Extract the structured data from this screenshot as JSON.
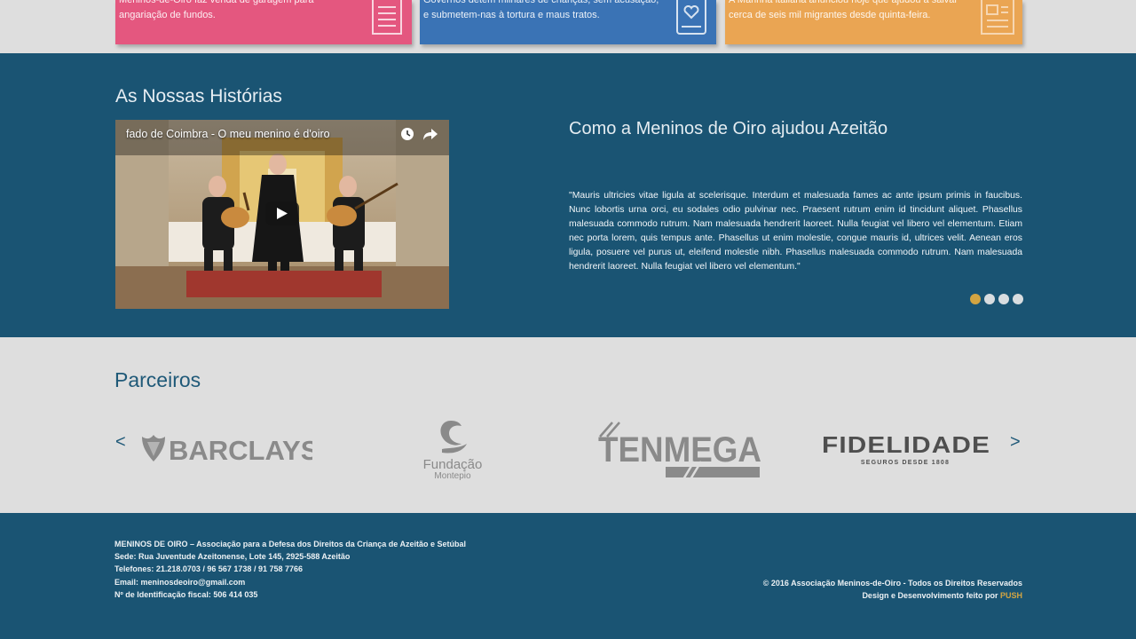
{
  "top_cards": [
    {
      "text": "Meninos-de-Oiro faz venda de garagem para angariação de fundos.",
      "color": "#e4577f",
      "icon": "newspaper-icon"
    },
    {
      "text": "Governos detêm milhares de crianças, sem acusação, e submetem-nas à tortura e maus tratos.",
      "color": "#3a73b5",
      "icon": "tablet-heart-icon"
    },
    {
      "text": "A Marinha italiana anunciou hoje que ajudou a salvar cerca de seis mil migrantes desde quinta-feira.",
      "color": "#eaa553",
      "icon": "newspaper-icon"
    }
  ],
  "stories": {
    "title": "As Nossas Histórias",
    "video": {
      "title": "fado de Coimbra - O meu menino é d'oiro"
    },
    "heading": "Como a Meninos de Oiro ajudou Azeitão",
    "quote": "\"Mauris ultricies vitae ligula at scelerisque. Interdum et malesuada fames ac ante ipsum primis in faucibus. Nunc lobortis urna orci, eu sodales odio pulvinar nec. Praesent rutrum enim id tincidunt aliquet. Phasellus malesuada commodo rutrum. Nam malesuada hendrerit laoreet. Nulla feugiat vel libero vel elementum. Etiam nec porta lorem, quis tempus ante. Phasellus ut enim molestie, congue mauris id, ultrices velit. Aenean eros ligula, posuere vel purus ut, eleifend molestie nibh. Phasellus malesuada commodo rutrum. Nam malesuada hendrerit laoreet. Nulla feugiat vel libero vel elementum.\"",
    "slides": 4,
    "active_slide": 1,
    "active_dot_color": "#d3a542"
  },
  "partners": {
    "title": "Parceiros",
    "prev": "<",
    "next": ">",
    "logos": [
      {
        "name": "BARCLAYS"
      },
      {
        "name": "Fundação",
        "sub": "Montepio"
      },
      {
        "name": "TENMEGA"
      },
      {
        "name": "FIDELIDADE",
        "sub": "SEGUROS DESDE 1808"
      }
    ]
  },
  "footer": {
    "org": "MENINOS DE OIRO – Associação para a Defesa dos Direitos da Criança de Azeitão e Setúbal",
    "address": "Sede: Rua Juventude Azeitonense, Lote 145, 2925-588 Azeitão",
    "phones": "Telefones: 21.218.0703 / 96 567 1738 / 91 758 7766",
    "email": "Email: meninosdeoiro@gmail.com",
    "nif": "Nº de Identificação fiscal: 506 414 035",
    "copyright": "© 2016 Associação Meninos-de-Oiro - Todos os Direitos Reservados",
    "credit": "Design e Desenvolvimento feito por",
    "credit_link": "PUSH"
  },
  "colors": {
    "dark_blue": "#1a5473",
    "gold": "#d3a542",
    "light_bg": "#dedede"
  }
}
